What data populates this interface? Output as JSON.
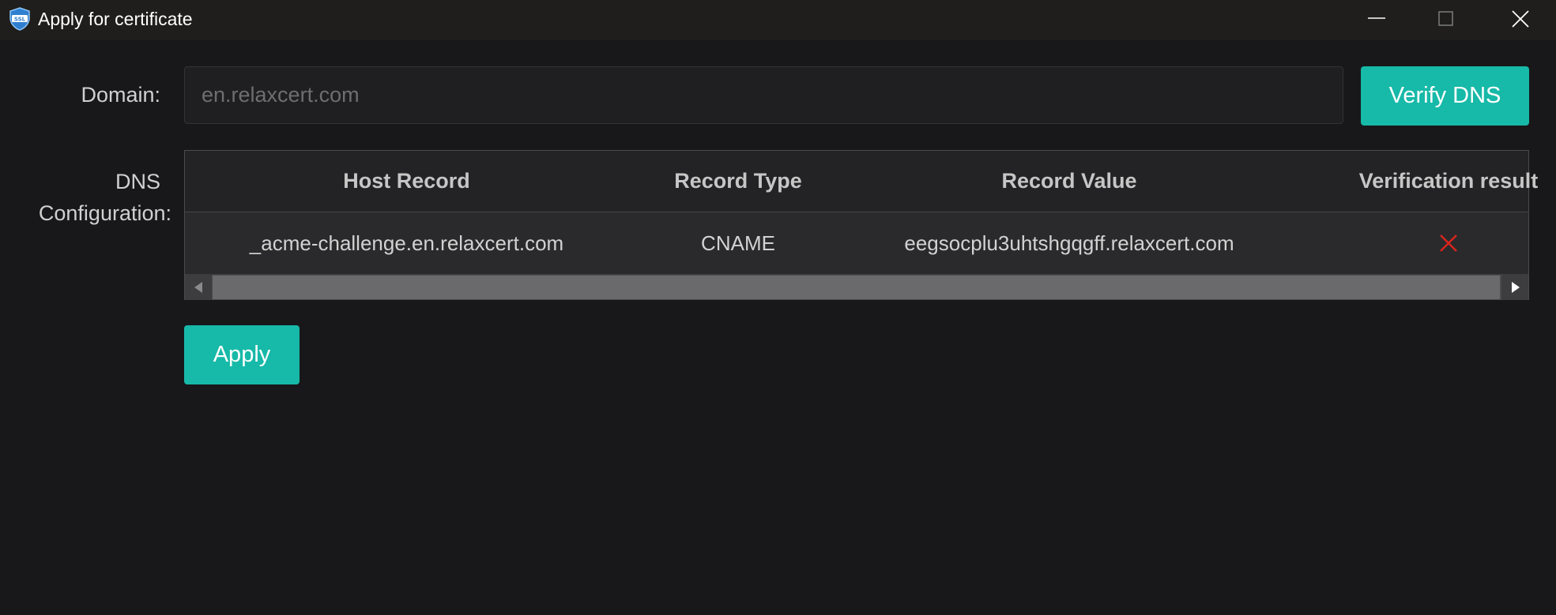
{
  "window": {
    "title": "Apply for certificate",
    "icon": "ssl-shield-icon",
    "icon_text": "SSL",
    "controls": [
      "minimize-icon",
      "maximize-icon",
      "close-icon"
    ]
  },
  "form": {
    "domain_label": "Domain:",
    "domain_value": "",
    "domain_placeholder": "en.relaxcert.com",
    "verify_button": "Verify DNS",
    "dns_label_line1": "DNS",
    "dns_label_line2": "Configuration:",
    "apply_button": "Apply"
  },
  "dns_table": {
    "columns": [
      "Host Record",
      "Record Type",
      "Record Value",
      "Verification result"
    ],
    "rows": [
      {
        "host_record": "_acme-challenge.en.relaxcert.com",
        "record_type": "CNAME",
        "record_value": "eegsocplu3uhtshgqgff.relaxcert.com",
        "verification_result": "failed-x-icon"
      }
    ]
  },
  "colors": {
    "accent": "#17b9a8",
    "background": "#18181a",
    "fail": "#d9251c"
  }
}
